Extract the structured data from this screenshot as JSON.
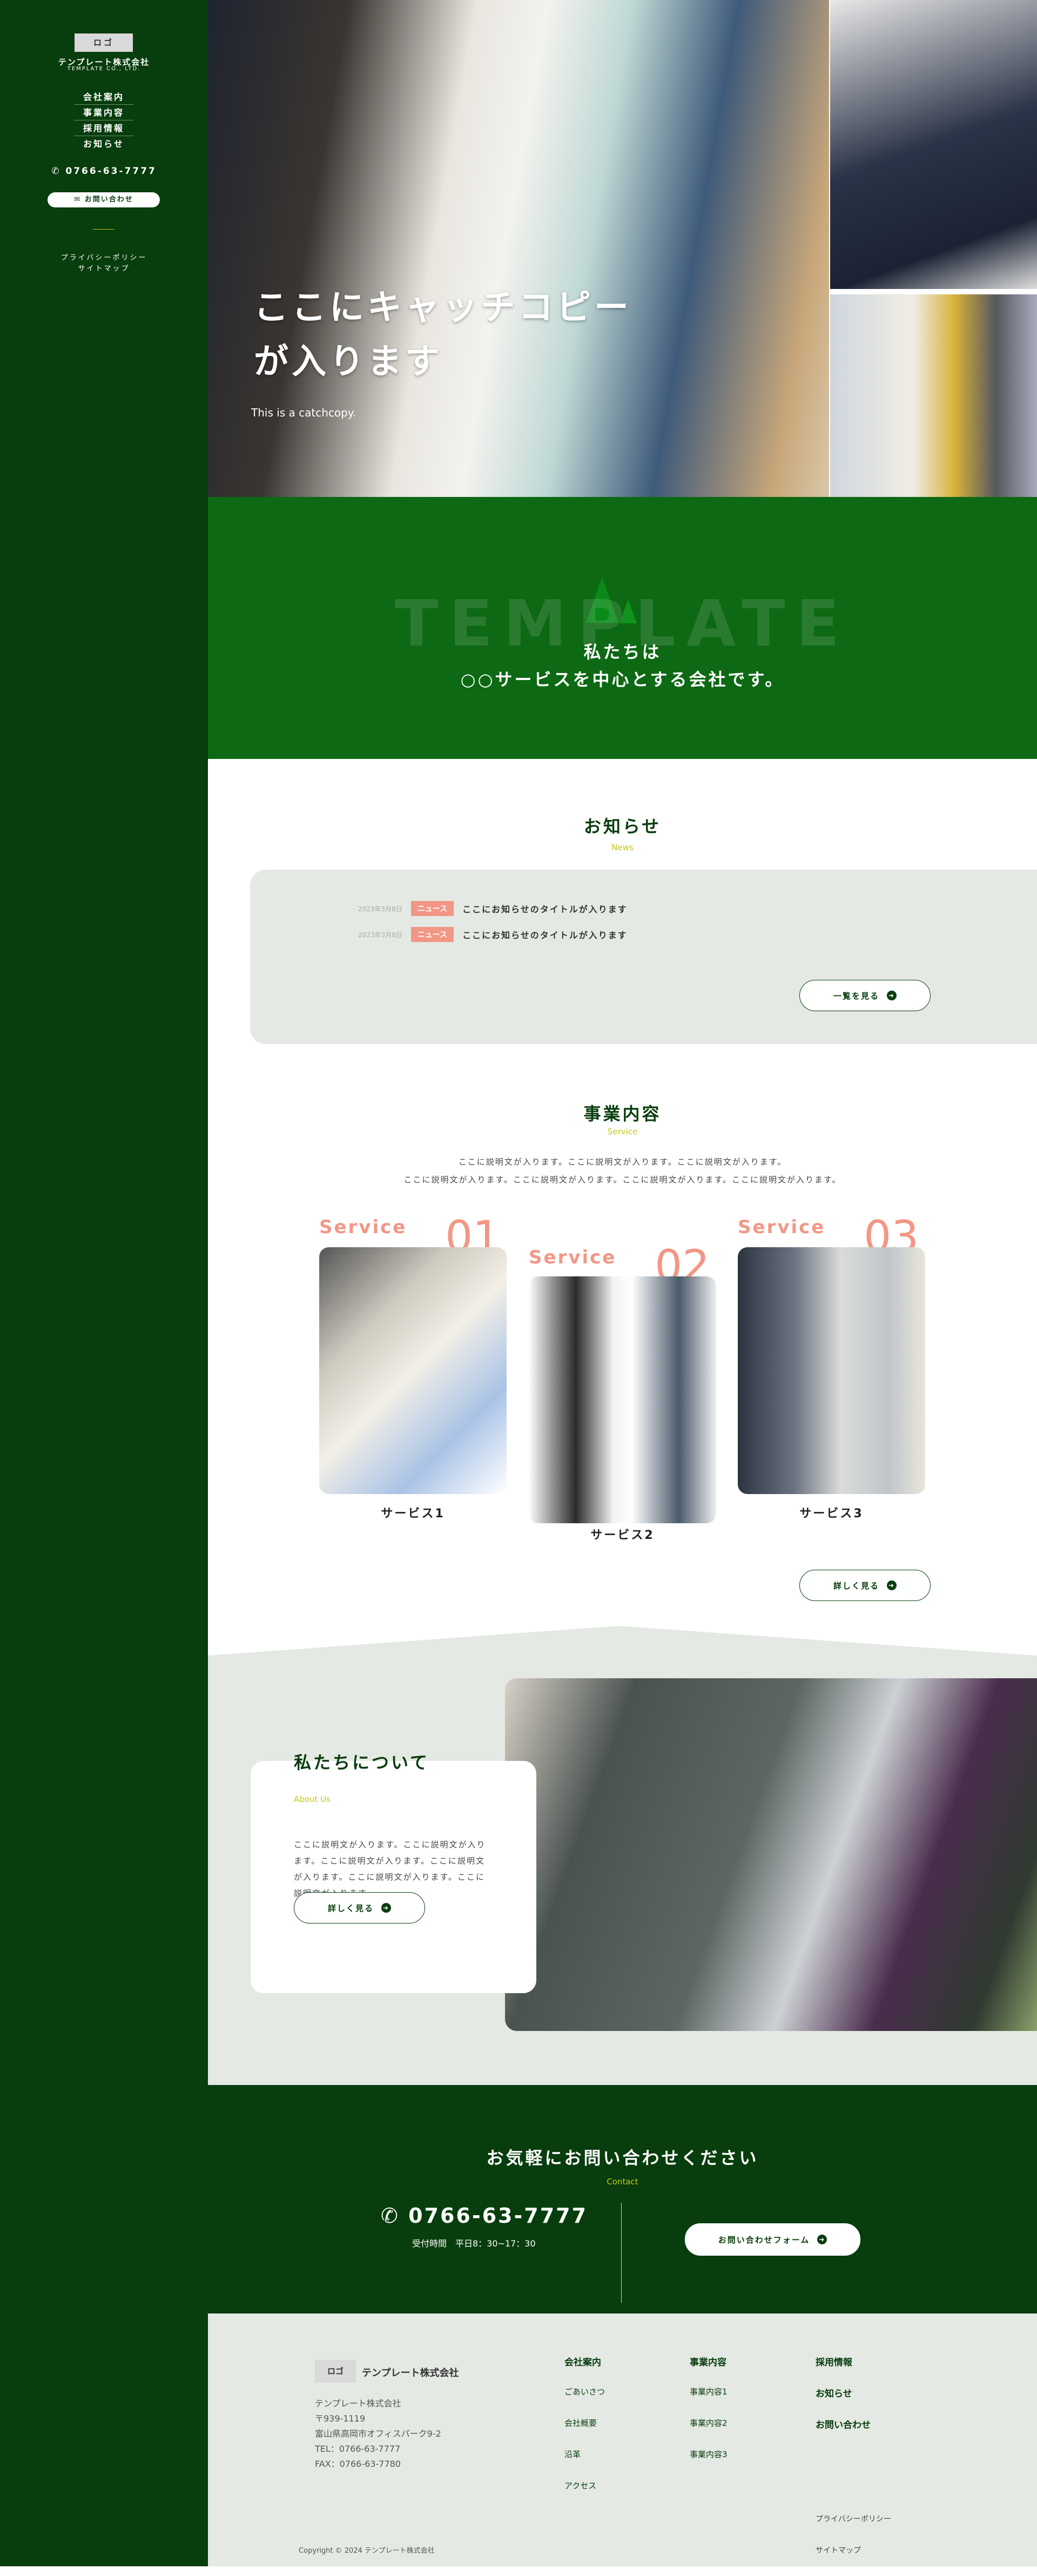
{
  "colors": {
    "sidebar": "#083d0d",
    "intro_bg": "#0d6914",
    "accent_yellow": "#c4c81e",
    "salmon": "#f29785",
    "light_bg": "#e4e9e3"
  },
  "sidebar": {
    "logo": "ロゴ",
    "company_name": "テンプレート株式会社",
    "company_en": "TEMPLATE CO., LTD.",
    "nav": [
      "会社案内",
      "事業内容",
      "採用情報",
      "お知らせ"
    ],
    "phone_icon": "phone-icon",
    "phone": "0766-63-7777",
    "contact_icon": "mail-icon",
    "contact_label": "お問い合わせ",
    "links": [
      "プライバシーポリシー",
      "サイトマップ"
    ]
  },
  "hero": {
    "catch_line1": "ここにキャッチコピー",
    "catch_line2": "が入ります",
    "catch_en": "This is a catchcopy."
  },
  "intro": {
    "bg_text": "TEMPLATE",
    "line1": "私たちは",
    "line2": "○○サービスを中心とする会社です。"
  },
  "news": {
    "title": "お知らせ",
    "subtitle": "News",
    "items": [
      {
        "date": "2023年3月8日",
        "tag": "ニュース",
        "title": "ここにお知らせのタイトルが入ります"
      },
      {
        "date": "2023年3月8日",
        "tag": "ニュース",
        "title": "ここにお知らせのタイトルが入ります"
      }
    ],
    "more_label": "一覧を見る"
  },
  "services": {
    "title": "事業内容",
    "subtitle": "Service",
    "desc_line1": "ここに説明文が入ります。ここに説明文が入ります。ここに説明文が入ります。",
    "desc_line2": "ここに説明文が入ります。ここに説明文が入ります。ここに説明文が入ります。ここに説明文が入ります。",
    "items": [
      {
        "label": "Service",
        "num": "01",
        "name": "サービス1"
      },
      {
        "label": "Service",
        "num": "02",
        "name": "サービス2"
      },
      {
        "label": "Service",
        "num": "03",
        "name": "サービス3"
      }
    ],
    "more_label": "詳しく見る"
  },
  "about": {
    "title": "私たちについて",
    "subtitle": "About Us",
    "text": "ここに説明文が入ります。ここに説明文が入ります。ここに説明文が入ります。ここに説明文が入ります。ここに説明文が入ります。ここに説明文が入ります。",
    "more_label": "詳しく見る"
  },
  "contact": {
    "title": "お気軽にお問い合わせください",
    "subtitle": "Contact",
    "phone": "0766-63-7777",
    "hours": "受付時間　平日8：30~17：30",
    "form_label": "お問い合わせフォーム"
  },
  "footer": {
    "logo": "ロゴ",
    "company_name": "テンプレート株式会社",
    "address": [
      "テンプレート株式会社",
      "〒939-1119",
      "富山県高岡市オフィスパーク9-2",
      "TEL：0766-63-7777",
      "FAX：0766-63-7780"
    ],
    "col1": {
      "head": "会社案内",
      "items": [
        "ごあいさつ",
        "会社概要",
        "沿革",
        "アクセス"
      ]
    },
    "col2": {
      "head": "事業内容",
      "items": [
        "事業内容1",
        "事業内容2",
        "事業内容3"
      ]
    },
    "col3": {
      "items": [
        "採用情報",
        "お知らせ",
        "お問い合わせ"
      ]
    },
    "links": [
      "プライバシーポリシー",
      "サイトマップ"
    ],
    "copyright": "Copyright © 2024 テンプレート株式会社"
  }
}
